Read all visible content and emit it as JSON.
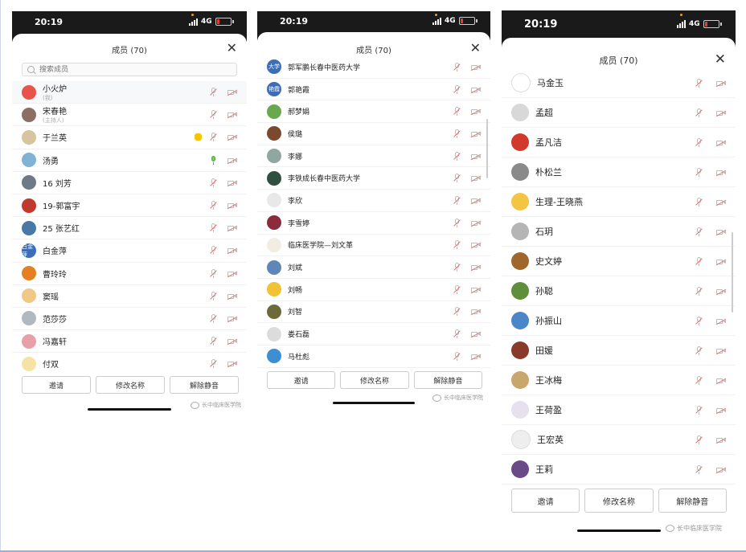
{
  "screens": [
    {
      "status": {
        "time": "20:19",
        "network": "4G"
      },
      "title": "成员 (70)",
      "search_placeholder": "搜索成员",
      "members": [
        {
          "name": "小火炉",
          "sub": "(我)",
          "avatar": "#e8544a",
          "mic": "muted"
        },
        {
          "name": "宋春艳",
          "sub": "(主持人)",
          "avatar": "#8d6e63",
          "mic": "muted"
        },
        {
          "name": "于兰英",
          "avatar": "#d9c4a0",
          "mic": "muted",
          "hand": true
        },
        {
          "name": "汤勇",
          "avatar": "#7fb3d5",
          "mic": "on"
        },
        {
          "name": "16  刘芳",
          "avatar": "#6d7a87",
          "mic": "muted"
        },
        {
          "name": "19-郭富宇",
          "avatar": "#c0392b",
          "mic": "muted"
        },
        {
          "name": "25 张艺红",
          "avatar": "#4a78a6",
          "mic": "muted"
        },
        {
          "name": "白金萍",
          "avatar": "#3d6db5",
          "avatar_text": "白金萍",
          "mic": "muted"
        },
        {
          "name": "曹玲玲",
          "avatar": "#e67e22",
          "mic": "muted"
        },
        {
          "name": "窦瑶",
          "avatar": "#f0c987",
          "mic": "muted"
        },
        {
          "name": "范莎莎",
          "avatar": "#b0b8c0",
          "mic": "muted"
        },
        {
          "name": "冯嘉轩",
          "avatar": "#e8a0a8",
          "mic": "muted"
        },
        {
          "name": "付双",
          "avatar": "#f5e3a6",
          "mic": "muted"
        }
      ],
      "buttons": [
        "邀请",
        "修改名称",
        "解除静音"
      ],
      "footer": "长中临床医学院"
    },
    {
      "status": {
        "time": "20:19",
        "network": "4G"
      },
      "title": "成员 (70)",
      "members": [
        {
          "name": "郭军鹏长春中医药大学",
          "avatar": "#3d6db5",
          "avatar_text": "大学",
          "mic": "muted"
        },
        {
          "name": "郭艳霞",
          "avatar": "#3d6db5",
          "avatar_text": "艳霞",
          "mic": "muted"
        },
        {
          "name": "郝梦娟",
          "avatar": "#6aa84f",
          "mic": "muted"
        },
        {
          "name": "侯璐",
          "avatar": "#7b4a2e",
          "mic": "muted"
        },
        {
          "name": "李娜",
          "avatar": "#8fa7a0",
          "mic": "muted"
        },
        {
          "name": "李铁成长春中医药大学",
          "avatar": "#2f4f3f",
          "mic": "muted"
        },
        {
          "name": "李欣",
          "avatar": "#e8e8e8",
          "mic": "muted"
        },
        {
          "name": "李雪婷",
          "avatar": "#8a2c3c",
          "mic": "muted"
        },
        {
          "name": "临床医学院—刘文革",
          "avatar": "#f3ece2",
          "mic": "muted"
        },
        {
          "name": "刘斌",
          "avatar": "#5e86b8",
          "mic": "muted"
        },
        {
          "name": "刘畅",
          "avatar": "#f1c232",
          "mic": "muted"
        },
        {
          "name": "刘智",
          "avatar": "#6b6b3a",
          "mic": "muted"
        },
        {
          "name": "娄石磊",
          "avatar": "#dcdcdc",
          "mic": "muted"
        },
        {
          "name": "马杜彪",
          "avatar": "#3d8fd1",
          "mic": "muted"
        }
      ],
      "buttons": [
        "邀请",
        "修改名称",
        "解除静音"
      ],
      "footer": "长中临床医学院"
    },
    {
      "status": {
        "time": "20:19",
        "network": "4G"
      },
      "title": "成员 (70)",
      "members": [
        {
          "name": "马金玉",
          "avatar": "#ffffff",
          "mic": "muted"
        },
        {
          "name": "孟超",
          "avatar": "#d8d8d8",
          "mic": "muted"
        },
        {
          "name": "孟凡洁",
          "avatar": "#d0392b",
          "mic": "muted"
        },
        {
          "name": "朴松兰",
          "avatar": "#8a8a8a",
          "mic": "muted"
        },
        {
          "name": "生理-王晓燕",
          "avatar": "#f4c542",
          "mic": "muted"
        },
        {
          "name": "石玥",
          "avatar": "#b5b5b5",
          "mic": "muted"
        },
        {
          "name": "史文婷",
          "avatar": "#a0672d",
          "mic": "muted"
        },
        {
          "name": "孙聪",
          "avatar": "#5f8f3a",
          "mic": "muted"
        },
        {
          "name": "孙振山",
          "avatar": "#4a86c8",
          "mic": "muted"
        },
        {
          "name": "田媛",
          "avatar": "#8a3a2a",
          "mic": "muted"
        },
        {
          "name": "王冰梅",
          "avatar": "#c9a66b",
          "mic": "muted"
        },
        {
          "name": "王荷盈",
          "avatar": "#e6e0ef",
          "mic": "muted"
        },
        {
          "name": "王宏英",
          "avatar": "#eeeeee",
          "mic": "muted"
        },
        {
          "name": "王莉",
          "avatar": "#6b4a8a",
          "mic": "muted"
        }
      ],
      "buttons": [
        "邀请",
        "修改名称",
        "解除静音"
      ],
      "footer": "长中临床医学院"
    }
  ]
}
